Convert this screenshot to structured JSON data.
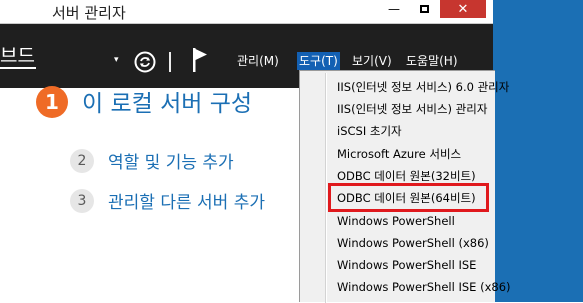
{
  "window": {
    "title": "서버 관리자",
    "minimize_label": "—",
    "close_label": "✕"
  },
  "header": {
    "title": "브드",
    "dropdown_arrow": "▾",
    "menu": [
      {
        "label": "관리(M)",
        "selected": false
      },
      {
        "label": "도구(T)",
        "selected": true
      },
      {
        "label": "보기(V)",
        "selected": false
      },
      {
        "label": "도움말(H)",
        "selected": false
      }
    ]
  },
  "welcome": {
    "steps": [
      {
        "number": "1",
        "label": "이 로컬 서버 구성"
      },
      {
        "number": "2",
        "label": "역할 및 기능 추가"
      },
      {
        "number": "3",
        "label": "관리할 다른 서버 추가"
      }
    ]
  },
  "tools_menu": {
    "items": [
      "IIS(인터넷 정보 서비스) 6.0 관리자",
      "IIS(인터넷 정보 서비스) 관리자",
      "iSCSI 초기자",
      "Microsoft Azure 서비스",
      "ODBC 데이터 원본(32비트)",
      "ODBC 데이터 원본(64비트)",
      "Windows PowerShell",
      "Windows PowerShell (x86)",
      "Windows PowerShell ISE",
      "Windows PowerShell ISE (x86)"
    ],
    "highlighted_item": "ODBC 데이터 원본(64비트)"
  },
  "colors": {
    "header_bg": "#1f1f1f",
    "accent_blue": "#1b6fb4",
    "step_orange": "#ef6b26",
    "highlight_red": "#e0191d"
  }
}
